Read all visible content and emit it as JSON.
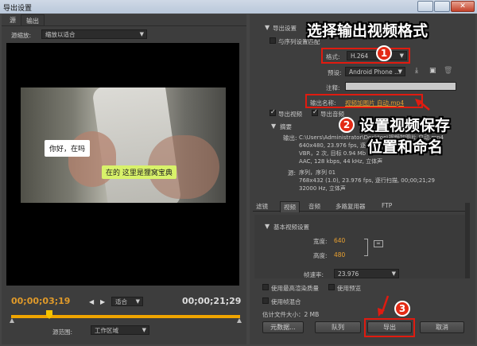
{
  "window": {
    "title": "导出设置"
  },
  "left_panel": {
    "tabs": [
      "源",
      "输出"
    ],
    "source_scaling_label": "源缩放:",
    "source_scaling_value": "缩放以适合",
    "subtitle_1": "你好，在吗",
    "subtitle_2": "在的  这里是狸窝宝典",
    "timecode_current": "00;00;03;19",
    "timecode_total": "00;00;21;29",
    "fit_value": "适合",
    "source_range_label": "源范围:",
    "source_range_value": "工作区域"
  },
  "export_settings": {
    "header": "导出设置",
    "match_sequence_label": "与序列设置匹配",
    "format_label": "格式:",
    "format_value": "H.264",
    "preset_label": "预设:",
    "preset_value": "Android Phone ...",
    "comment_label": "注释:",
    "output_name_label": "输出名称:",
    "output_name_value": "视频加图片 自动.mp4",
    "export_video_label": "导出视频",
    "export_audio_label": "导出音频",
    "summary_header": "摘要",
    "output_label": "输出:",
    "output_lines": [
      "C:\\Users\\Administrator\\Desktop\\视频加图片 自动.mp4",
      "640x480, 23.976 fps, 逐行",
      "VBR，2 次, 目标 0.94 Mb",
      "AAC, 128 kbps, 44 kHz, 立体声"
    ],
    "source_label": "源:",
    "source_lines": [
      "序列，序列 01",
      "768x432 (1.0), 23.976 fps, 逐行扫描, 00;00;21;29",
      "32000 Hz, 立体声"
    ]
  },
  "settings_tabs": [
    "滤镜",
    "视频",
    "音频",
    "多路复用器",
    "FTP"
  ],
  "video_settings": {
    "header": "基本视频设置",
    "width_label": "宽度:",
    "width_value": "640",
    "height_label": "高度:",
    "height_value": "480",
    "framerate_label": "帧速率:",
    "framerate_value": "23.976"
  },
  "bottom_options": {
    "max_render_quality": "使用最高渲染质量",
    "use_preview": "使用预览",
    "frame_blending": "使用帧混合",
    "estimated_size": "估计文件大小：2 MB"
  },
  "buttons": {
    "metadata": "元数据...",
    "queue": "队列",
    "export": "导出",
    "cancel": "取消"
  },
  "annotations": {
    "text_1": "选择输出视频格式",
    "text_2_line1": "设置视频保存",
    "text_2_line2": "位置和命名",
    "num_1": "1",
    "num_2": "2",
    "num_3": "3"
  },
  "colors": {
    "accent_orange": "#e8a030",
    "timecode_orange": "#e09a2a",
    "annotation_red": "#e01b10"
  }
}
